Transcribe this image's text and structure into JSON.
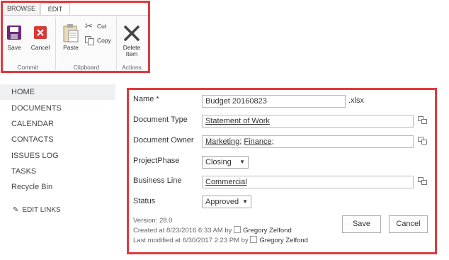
{
  "ribbon": {
    "tabs": [
      {
        "label": "BROWSE"
      },
      {
        "label": "EDIT"
      }
    ],
    "buttons": {
      "save": "Save",
      "cancel": "Cancel",
      "paste": "Paste",
      "cut": "Cut",
      "copy": "Copy",
      "delete_line1": "Delete",
      "delete_line2": "Item"
    },
    "groups": {
      "commit": "Commit",
      "clipboard": "Clipboard",
      "actions": "Actions"
    }
  },
  "nav": {
    "items": [
      "HOME",
      "DOCUMENTS",
      "CALENDAR",
      "CONTACTS",
      "ISSUES LOG",
      "TASKS",
      "Recycle Bin"
    ],
    "edit_links": "EDIT LINKS"
  },
  "form": {
    "name_label": "Name *",
    "name_value": "Budget 20160823",
    "name_ext": ".xlsx",
    "doc_type_label": "Document Type",
    "doc_type_value": "Statement of Work",
    "doc_owner_label": "Document Owner",
    "doc_owner_values": [
      "Marketing",
      "Finance"
    ],
    "doc_owner_sep": ";",
    "phase_label": "ProjectPhase",
    "phase_value": "Closing",
    "business_line_label": "Business Line",
    "business_line_value": "Commercial",
    "status_label": "Status",
    "status_value": "Approved",
    "version": "Version: 28.0",
    "created_prefix": "Created at 8/23/2016 6:33 AM  by",
    "created_by": "Gregory Zelfond",
    "modified_prefix": "Last modified at 6/30/2017 2:23 PM  by",
    "modified_by": "Gregory Zelfond",
    "save_button": "Save",
    "cancel_button": "Cancel"
  },
  "colors": {
    "highlight": "#e0393e",
    "save_icon": "#6a2a78",
    "cancel_icon": "#d73b36"
  }
}
